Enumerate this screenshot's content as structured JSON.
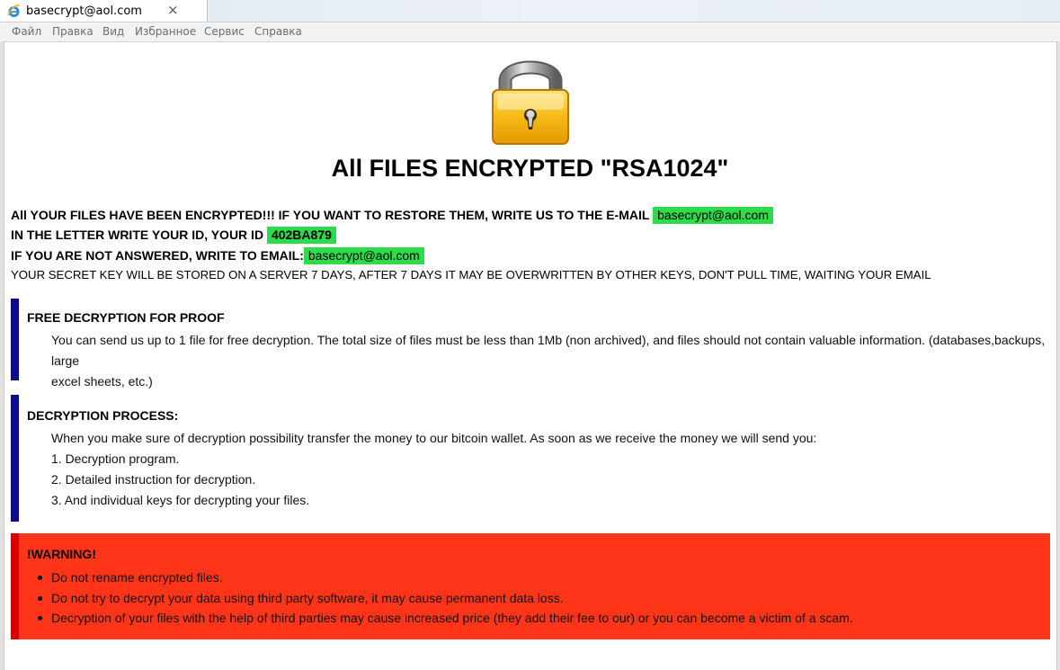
{
  "browser": {
    "tab_title": "basecrypt@aol.com",
    "close_glyph": "×",
    "menu": [
      "Файл",
      "Правка",
      "Вид",
      "Избранное",
      "Сервис",
      "Справка"
    ]
  },
  "page": {
    "headline": "All FILES ENCRYPTED \"RSA1024\"",
    "line1": "All YOUR FILES HAVE BEEN ENCRYPTED!!! IF YOU WANT TO RESTORE THEM, WRITE US TO THE E-MAIL",
    "email": "basecrypt@aol.com",
    "line2": "IN THE LETTER WRITE YOUR ID, YOUR ID",
    "id": "402BA879",
    "line3": "IF YOU ARE NOT ANSWERED, WRITE TO EMAIL:",
    "email2": "basecrypt@aol.com",
    "line4": "YOUR SECRET KEY WILL BE STORED ON A SERVER 7 DAYS, AFTER 7 DAYS IT MAY BE OVERWRITTEN BY OTHER KEYS, DON'T PULL TIME, WAITING YOUR EMAIL",
    "proof": {
      "title": "FREE DECRYPTION FOR PROOF",
      "text_line1": "You can send us up to 1 file for free decryption. The total size of files must be less than 1Mb (non archived), and files should not contain valuable information. (databases,backups, large",
      "text_line2": "excel sheets, etc.)"
    },
    "process": {
      "title": "DECRYPTION PROCESS:",
      "intro": "When you make sure of decryption possibility transfer the money to our bitcoin wallet. As soon as we receive the money we will send you:",
      "steps": [
        "1. Decryption program.",
        "2. Detailed instruction for decryption.",
        "3. And individual keys for decrypting your files."
      ]
    },
    "warning": {
      "title": "!WARNING!",
      "items": [
        "Do not rename encrypted files.",
        "Do not try to decrypt your data using third party software, it may cause permanent data loss.",
        "Decryption of your files with the help of third parties may cause increased price (they add their fee to our) or you can become a victim of a scam."
      ]
    }
  },
  "colors": {
    "highlight": "#2edb4a",
    "section_bar": "#0c0c8a",
    "warning_bg": "#ff3519",
    "warning_bar": "#d80000",
    "lock_body": "#f4b400"
  },
  "icons": {
    "tab": "internet-explorer-icon",
    "lock": "padlock-icon"
  }
}
